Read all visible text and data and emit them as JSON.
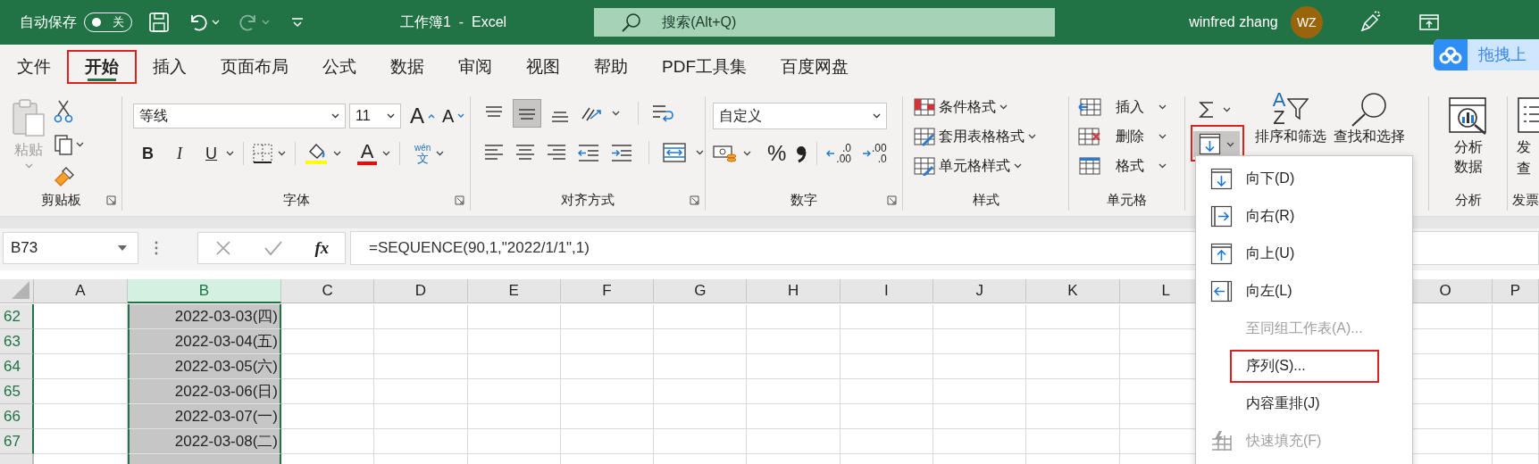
{
  "title_bar": {
    "autosave_label": "自动保存",
    "autosave": {
      "on": false,
      "label": "关"
    },
    "redo": {
      "disabled": true
    },
    "title": "工作簿1  -  Excel",
    "search": {
      "placeholder": "搜索(Alt+Q)"
    },
    "user": "winfred zhang",
    "avatar": "WZ"
  },
  "tabs": [
    {
      "label": "文件",
      "selected": false,
      "highlighted": false
    },
    {
      "label": "开始",
      "selected": true,
      "highlighted": true
    },
    {
      "label": "插入",
      "selected": false,
      "highlighted": false
    },
    {
      "label": "页面布局",
      "selected": false,
      "highlighted": false
    },
    {
      "label": "公式",
      "selected": false,
      "highlighted": false
    },
    {
      "label": "数据",
      "selected": false,
      "highlighted": false
    },
    {
      "label": "审阅",
      "selected": false,
      "highlighted": false
    },
    {
      "label": "视图",
      "selected": false,
      "highlighted": false
    },
    {
      "label": "帮助",
      "selected": false,
      "highlighted": false
    },
    {
      "label": "PDF工具集",
      "selected": false,
      "highlighted": false
    },
    {
      "label": "百度网盘",
      "selected": false,
      "highlighted": false
    }
  ],
  "upload_badge": {
    "label": "拖拽上"
  },
  "ribbon": {
    "clipboard": {
      "label": "剪贴板",
      "paste": {
        "label": "粘贴",
        "disabled": true
      }
    },
    "font": {
      "label": "字体",
      "font_name": "等线",
      "font_size": "11",
      "grow": "A",
      "shrink": "A",
      "bold": "B",
      "italic": "I",
      "underline": "U",
      "font_color": "A",
      "phonetic": {
        "top": "wén",
        "bottom": "文"
      }
    },
    "alignment": {
      "label": "对齐方式",
      "middle_align": {
        "selected": true
      }
    },
    "number": {
      "label": "数字",
      "format": "自定义",
      "percent": "%",
      "increase_decimal": {
        "top": ".0",
        "bottom": ".00"
      },
      "decrease_decimal": {
        "top": ".00",
        "bottom": ".0"
      }
    },
    "styles": {
      "label": "样式",
      "items": [
        {
          "label": "条件格式",
          "kind": "conditional"
        },
        {
          "label": "套用表格格式",
          "kind": "table"
        },
        {
          "label": "单元格样式",
          "kind": "cellstyle"
        }
      ]
    },
    "cells": {
      "label": "单元格",
      "items": [
        {
          "label": "插入",
          "kind": "insert"
        },
        {
          "label": "删除",
          "kind": "delete"
        },
        {
          "label": "格式",
          "kind": "format"
        }
      ]
    },
    "editing": {
      "fill": {
        "expanded": true,
        "highlighted": true
      },
      "sort_letters": [
        "A",
        "Z"
      ],
      "sort_filter": "排序和筛选",
      "find_select": "查找和选择"
    },
    "analysis": {
      "label": "分析",
      "button": "分析数据"
    },
    "invoice": {
      "label": "发票",
      "button_lines": [
        "发",
        "查"
      ]
    }
  },
  "formula_bar": {
    "name_box": "B73",
    "fx": "fx",
    "formula": "=SEQUENCE(90,1,\"2022/1/1\",1)"
  },
  "sheet": {
    "columns": [
      {
        "label": "A",
        "selected": false
      },
      {
        "label": "B",
        "selected": true
      },
      {
        "label": "C",
        "selected": false
      },
      {
        "label": "D",
        "selected": false
      },
      {
        "label": "E",
        "selected": false
      },
      {
        "label": "F",
        "selected": false
      },
      {
        "label": "G",
        "selected": false
      },
      {
        "label": "H",
        "selected": false
      },
      {
        "label": "I",
        "selected": false
      },
      {
        "label": "J",
        "selected": false
      },
      {
        "label": "K",
        "selected": false
      },
      {
        "label": "L",
        "selected": false
      },
      {
        "label": "O",
        "selected": false
      },
      {
        "label": "P",
        "selected": false
      }
    ],
    "rows": [
      {
        "number": "62",
        "selected": true,
        "B": "2022-03-03(四)"
      },
      {
        "number": "63",
        "selected": true,
        "B": "2022-03-04(五)"
      },
      {
        "number": "64",
        "selected": true,
        "B": "2022-03-05(六)"
      },
      {
        "number": "65",
        "selected": true,
        "B": "2022-03-06(日)"
      },
      {
        "number": "66",
        "selected": true,
        "B": "2022-03-07(一)"
      },
      {
        "number": "67",
        "selected": true,
        "B": "2022-03-08(二)"
      }
    ]
  },
  "fill_menu": {
    "items": [
      {
        "label": "向下(D)",
        "kind": "down",
        "disabled": false,
        "highlighted": false
      },
      {
        "label": "向右(R)",
        "kind": "right",
        "disabled": false,
        "highlighted": false
      },
      {
        "label": "向上(U)",
        "kind": "up",
        "disabled": false,
        "highlighted": false
      },
      {
        "label": "向左(L)",
        "kind": "left",
        "disabled": false,
        "highlighted": false
      },
      {
        "label": "至同组工作表(A)...",
        "kind": "plain",
        "disabled": true,
        "highlighted": false
      },
      {
        "label": "序列(S)...",
        "kind": "plain",
        "disabled": false,
        "highlighted": true
      },
      {
        "label": "内容重排(J)",
        "kind": "plain",
        "disabled": false,
        "highlighted": false
      },
      {
        "label": "快速填充(F)",
        "kind": "flash",
        "disabled": true,
        "highlighted": false
      }
    ]
  }
}
